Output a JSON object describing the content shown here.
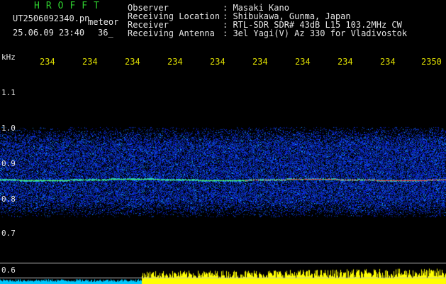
{
  "header": {
    "title": "HROFFT",
    "filename": "UT2506092340.pn",
    "meteor_label": "meteor",
    "datetime": "25.06.09 23:40",
    "count": "36_",
    "fields": [
      {
        "label": "Observer",
        "value": ": Masaki Kano"
      },
      {
        "label": "Receiving Location",
        "value": ": Shibukawa, Gunma, Japan"
      },
      {
        "label": "Receiver",
        "value": ": RTL-SDR SDR# 43dB L15 103.2MHz CW"
      },
      {
        "label": "Receiving Antenna",
        "value": ": 3el Yagi(V) Az 330 for Vladivostok"
      }
    ]
  },
  "axis": {
    "unit": "kHz",
    "y_ticks": [
      "1.1",
      "1.0",
      "0.9",
      "0.8",
      "0.7",
      "0.6"
    ],
    "x_ticks": [
      "234",
      "234",
      "234",
      "234",
      "234",
      "234",
      "234",
      "234",
      "234",
      "2350"
    ]
  },
  "colors": {
    "title": "#2fd02f",
    "time_ticks": "#e0e000",
    "text": "#e6e6e6",
    "background": "#000000",
    "waterfall_noise": "#1a2bd0",
    "signal_trace": "#ff3030",
    "bottom_graph": "#ffff00",
    "bottom_graph_start": "#00c8ff"
  }
}
